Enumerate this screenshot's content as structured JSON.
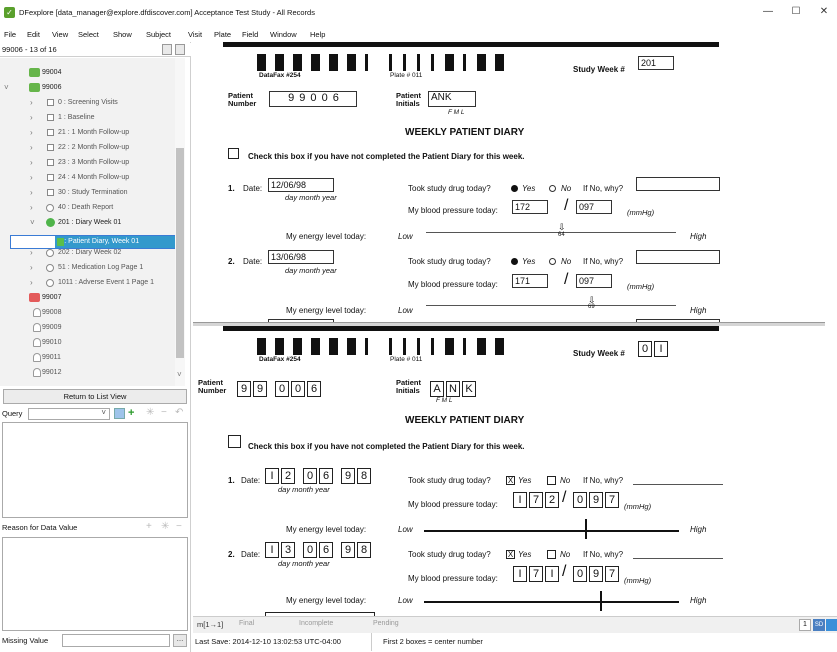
{
  "window": {
    "title": "DFexplore [data_manager@explore.dfdiscover.com] Acceptance Test Study - All Records"
  },
  "menu": [
    "File",
    "Edit",
    "View",
    "Select",
    "Show",
    "Subject",
    "Visit",
    "Plate",
    "Field",
    "Window",
    "Help"
  ],
  "left": {
    "count": "99006 - 13 of 16",
    "tree": [
      {
        "label": "99004",
        "kind": "patient-green",
        "indent": 0
      },
      {
        "label": "99006",
        "kind": "patient-green",
        "indent": 0,
        "open": true
      },
      {
        "label": "0 : Screening Visits",
        "kind": "visit",
        "indent": 1
      },
      {
        "label": "1 : Baseline",
        "kind": "visit",
        "indent": 1
      },
      {
        "label": "21 : 1 Month Follow-up",
        "kind": "visit",
        "indent": 1
      },
      {
        "label": "22 : 2 Month Follow-up",
        "kind": "visit",
        "indent": 1
      },
      {
        "label": "23 : 3 Month Follow-up",
        "kind": "visit",
        "indent": 1
      },
      {
        "label": "24 : 4 Month Follow-up",
        "kind": "visit",
        "indent": 1
      },
      {
        "label": "30 : Study Termination",
        "kind": "visit",
        "indent": 1
      },
      {
        "label": "40 : Death Report",
        "kind": "circle",
        "indent": 1
      },
      {
        "label": "201 : Diary Week 01",
        "kind": "green-circle",
        "indent": 1,
        "open": true
      },
      {
        "label": "11: Patient Diary, Week 01",
        "kind": "selected",
        "indent": 2
      },
      {
        "label": "202 : Diary Week 02",
        "kind": "circle",
        "indent": 1
      },
      {
        "label": "51 : Medication Log Page 1",
        "kind": "circle",
        "indent": 1
      },
      {
        "label": "1011 : Adverse Event 1 Page 1",
        "kind": "circle",
        "indent": 1
      },
      {
        "label": "99007",
        "kind": "patient-red",
        "indent": 0
      },
      {
        "label": "99008",
        "kind": "person",
        "indent": 0
      },
      {
        "label": "99009",
        "kind": "person",
        "indent": 0
      },
      {
        "label": "99010",
        "kind": "person",
        "indent": 0
      },
      {
        "label": "99011",
        "kind": "person",
        "indent": 0
      },
      {
        "label": "99012",
        "kind": "person",
        "indent": 0
      }
    ],
    "return_label": "Return to List View",
    "query_label": "Query",
    "reason_label": "Reason for Data Value",
    "missing_label": "Missing Value"
  },
  "doc1": {
    "datafax": "DataFax #254",
    "plate": "Plate # 011",
    "study_week_label": "Study Week #",
    "study_week": "201",
    "patient_label1": "Patient",
    "patient_label2": "Number",
    "patient_number": "9 9 0 0 6",
    "initials_label1": "Patient",
    "initials_label2": "Initials",
    "initials": "ANK",
    "fml": "F   M   L",
    "heading": "WEEKLY PATIENT DIARY",
    "check_text": "Check this box if you have not completed the Patient Diary for this week.",
    "e1_num": "1.",
    "e1_date_label": "Date:",
    "e1_date": "12/06/98",
    "e1_dmy": "day      month      year",
    "drug_q": "Took study drug today?",
    "yes": "Yes",
    "no": "No",
    "ifno": "If No, why?",
    "bp_label": "My blood pressure today:",
    "e1_sys": "172",
    "e1_dia": "097",
    "mmhg": "(mmHg)",
    "energy_label": "My energy level today:",
    "low": "Low",
    "high": "High",
    "e1_energy": "64",
    "e2_num": "2.",
    "e2_date": "13/06/98",
    "e2_sys": "171",
    "e2_dia": "097",
    "e2_energy": "69",
    "slash": "/"
  },
  "doc2": {
    "study_week_cells": [
      "0",
      "I"
    ],
    "patient_cells": [
      "9",
      "9",
      "0",
      "0",
      "6"
    ],
    "initials_cells": [
      "A",
      "N",
      "K"
    ],
    "e1_date_cells": [
      "I",
      "2",
      "0",
      "6",
      "9",
      "8"
    ],
    "e1_bp_cells": [
      "I",
      "7",
      "2",
      "0",
      "9",
      "7"
    ],
    "e2_date_cells": [
      "I",
      "3",
      "0",
      "6",
      "9",
      "8"
    ],
    "e2_bp_cells": [
      "I",
      "7",
      "I",
      "0",
      "9",
      "7"
    ],
    "check_mark": "X"
  },
  "status": {
    "m": "m[1→1]",
    "final": "Final",
    "incomplete": "Incomplete",
    "pending": "Pending",
    "page": "1",
    "sd": "SD",
    "last_save": "Last Save: 2014-12-10 13:02:53 UTC-04:00",
    "hint": "First 2 boxes = center number"
  }
}
